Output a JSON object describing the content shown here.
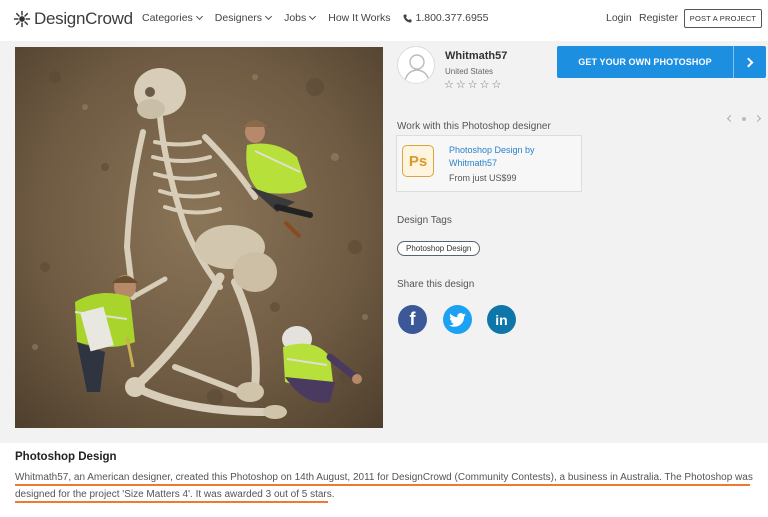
{
  "nav": {
    "brand": "DesignCrowd",
    "menu": [
      "Categories",
      "Designers",
      "Jobs"
    ],
    "how_it_works": "How It Works",
    "phone": "1.800.377.6955",
    "login": "Login",
    "register": "Register",
    "post_project": "POST A PROJECT"
  },
  "designer": {
    "name": "Whitmath57",
    "country": "United States",
    "stars": [
      "☆",
      "☆",
      "☆",
      "☆",
      "☆"
    ]
  },
  "cta": {
    "label": "GET YOUR OWN PHOTOSHOP"
  },
  "work": {
    "label": "Work with this Photoshop designer",
    "icon_text": "Ps",
    "link": "Photoshop Design by Whitmath57",
    "price": "From just US$99"
  },
  "tags": {
    "label": "Design Tags",
    "items": [
      "Photoshop Design"
    ]
  },
  "share": {
    "label": "Share this design",
    "facebook": "f",
    "linkedin": "in"
  },
  "design": {
    "title": "Photoshop Design",
    "description": "Whitmath57, an American designer, created this Photoshop on 14th August, 2011 for DesignCrowd (Community Contests), a business in Australia. The Photoshop was designed for the project 'Size Matters 4'. It was awarded 3 out of 5 stars."
  },
  "colors": {
    "accent": "#1d8fe1",
    "underline": "#f07830",
    "facebook": "#3b5998",
    "twitter": "#1da1f2",
    "linkedin": "#0e76a8"
  }
}
